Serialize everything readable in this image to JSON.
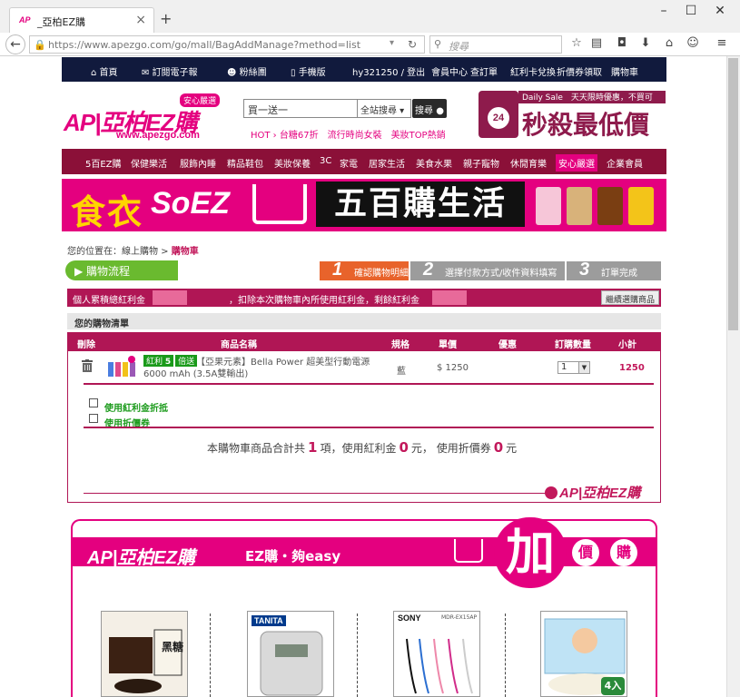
{
  "browser": {
    "tab_title": "_亞柏EZ購",
    "favicon_text": "AP",
    "url": "https://www.apezgo.com/go/mall/BagAddManage?method=list",
    "search_placeholder": "搜尋"
  },
  "topnav": {
    "items": [
      "首頁",
      "訂閱電子報",
      "粉絲團",
      "手機版"
    ],
    "user": "hy321250 / 登出",
    "links": [
      "會員中心",
      "查訂單",
      "紅利卡兌換",
      "折價券領取",
      "購物車"
    ]
  },
  "header": {
    "logo": "AP|亞柏EZ購",
    "logo_sub": "www.apezgo.com",
    "logo_badge": "安心嚴選",
    "search_value": "買一送一",
    "search_scope": "全站搜尋",
    "search_button": "搜尋",
    "hot_links": "HOT › 台糖67折　流行時尚女裝　美妝TOP熱銷",
    "promo_daily": "Daily Sale　天天限時優惠，不買可惜！",
    "promo_hours": "24",
    "promo_title": "秒殺最低價"
  },
  "categories": [
    "5百EZ購",
    "保健樂活",
    "服飾內睡",
    "精品鞋包",
    "美妝保養",
    "3C",
    "家電",
    "居家生活",
    "美食水果",
    "親子寵物",
    "休閒育樂",
    "安心嚴選",
    "企業會員"
  ],
  "banner": {
    "text1": "食衣",
    "text2": "SoEZ",
    "text3": "五百購生活"
  },
  "breadcrumb": {
    "prefix": "您的位置在：線上購物 > ",
    "current": "購物車"
  },
  "flow": {
    "label": "購物流程",
    "steps": [
      {
        "n": "1",
        "label": "確認購物明細"
      },
      {
        "n": "2",
        "label": "選擇付款方式/收件資料填寫"
      },
      {
        "n": "3",
        "label": "訂單完成"
      }
    ]
  },
  "bonus": {
    "label1": "個人累積總紅利金",
    "label2": "，扣除本次購物車內所使用紅利金，剩餘紅利金",
    "continue_button": "繼續選購商品"
  },
  "cart": {
    "title": "您的購物清單",
    "headers": [
      "刪除",
      "商品名稱",
      "規格",
      "單價",
      "優惠",
      "訂購數量",
      "小計"
    ],
    "item": {
      "tag1": "紅利",
      "tag2": "倍送",
      "tag_num": "5",
      "name_line1": "【亞果元素】Bella Power 超美型行動電源",
      "name_line2": "6000 mAh (3.5A雙輸出)",
      "spec": "藍",
      "price": "$ 1250",
      "qty": "1",
      "subtotal": "1250"
    },
    "option_bonus": "使用紅利金折抵",
    "option_coupon": "使用折價券",
    "summary_pre": "本購物車商品合計共",
    "summary_items": "1",
    "summary_mid1": "項，使用紅利金",
    "summary_bonus": "0",
    "summary_mid2": "元， 使用折價券",
    "summary_coupon": "0",
    "summary_post": "元",
    "footer_logo": "AP|亞柏EZ購"
  },
  "addon": {
    "logo": "AP|亞柏EZ購",
    "title": "EZ購・夠easy",
    "big": "加",
    "small1": "價",
    "small2": "購",
    "items": [
      {
        "brand": "",
        "label": "黑糖"
      },
      {
        "brand": "TANITA",
        "label": ""
      },
      {
        "brand": "SONY",
        "label": "MDR-EX15AP"
      },
      {
        "brand": "",
        "label": "4入"
      }
    ]
  },
  "colors": {
    "brand_pink": "#e4007f",
    "brand_maroon": "#b01655",
    "nav_navy": "#111a3d",
    "step_orange": "#e8632b",
    "flow_green": "#6aba2f"
  }
}
